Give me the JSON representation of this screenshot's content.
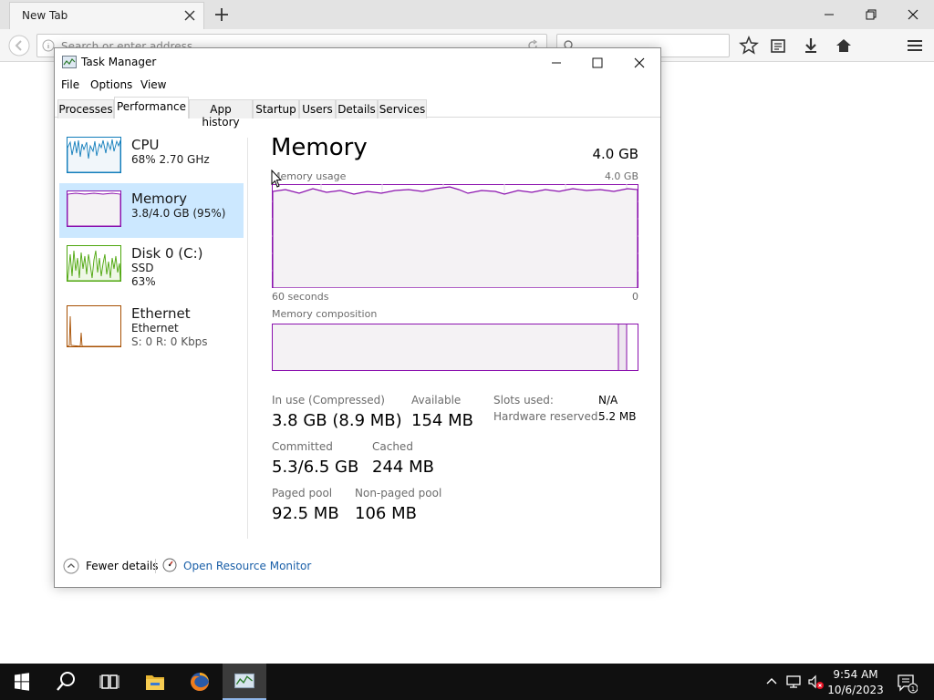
{
  "browser": {
    "tab_title": "New Tab",
    "url_placeholder": "Search or enter address",
    "icons": [
      "back-icon",
      "info-icon",
      "reload-icon",
      "search-icon",
      "bookmark-star-icon",
      "reading-list-icon",
      "download-icon",
      "home-icon",
      "hamburger-menu-icon"
    ]
  },
  "taskmanager": {
    "title": "Task Manager",
    "menu": [
      "File",
      "Options",
      "View"
    ],
    "tabs": [
      "Processes",
      "Performance",
      "App history",
      "Startup",
      "Users",
      "Details",
      "Services"
    ],
    "active_tab": "Performance",
    "sidebar": [
      {
        "name": "CPU",
        "line1": "68%  2.70 GHz",
        "line2": ""
      },
      {
        "name": "Memory",
        "line1": "3.8/4.0 GB (95%)",
        "line2": ""
      },
      {
        "name": "Disk 0 (C:)",
        "line1": "SSD",
        "line2": "63%"
      },
      {
        "name": "Ethernet",
        "line1": "Ethernet",
        "line2": "S: 0 R: 0 Kbps"
      }
    ],
    "memory": {
      "title": "Memory",
      "total": "4.0 GB",
      "usage_label": "Memory usage",
      "usage_max": "4.0 GB",
      "x_left": "60 seconds",
      "x_right": "0",
      "composition_label": "Memory composition",
      "in_use_label": "In use (Compressed)",
      "in_use_value": "3.8 GB (8.9 MB)",
      "available_label": "Available",
      "available_value": "154 MB",
      "committed_label": "Committed",
      "committed_value": "5.3/6.5 GB",
      "cached_label": "Cached",
      "cached_value": "244 MB",
      "paged_label": "Paged pool",
      "paged_value": "92.5 MB",
      "nonpaged_label": "Non-paged pool",
      "nonpaged_value": "106 MB",
      "slots_label": "Slots used:",
      "slots_value": "N/A",
      "hwres_label": "Hardware reserved:",
      "hwres_value": "5.2 MB"
    },
    "footer": {
      "fewer_details": "Fewer details",
      "open_resource_monitor": "Open Resource Monitor"
    }
  },
  "taskbar": {
    "time": "9:54 AM",
    "date": "10/6/2023",
    "notification_count": "1"
  },
  "colors": {
    "memory_accent": "#8b12ae",
    "cpu_accent": "#117dbb",
    "disk_accent": "#4da60c",
    "ethernet_accent": "#a74f01",
    "selection": "#cce8ff"
  }
}
